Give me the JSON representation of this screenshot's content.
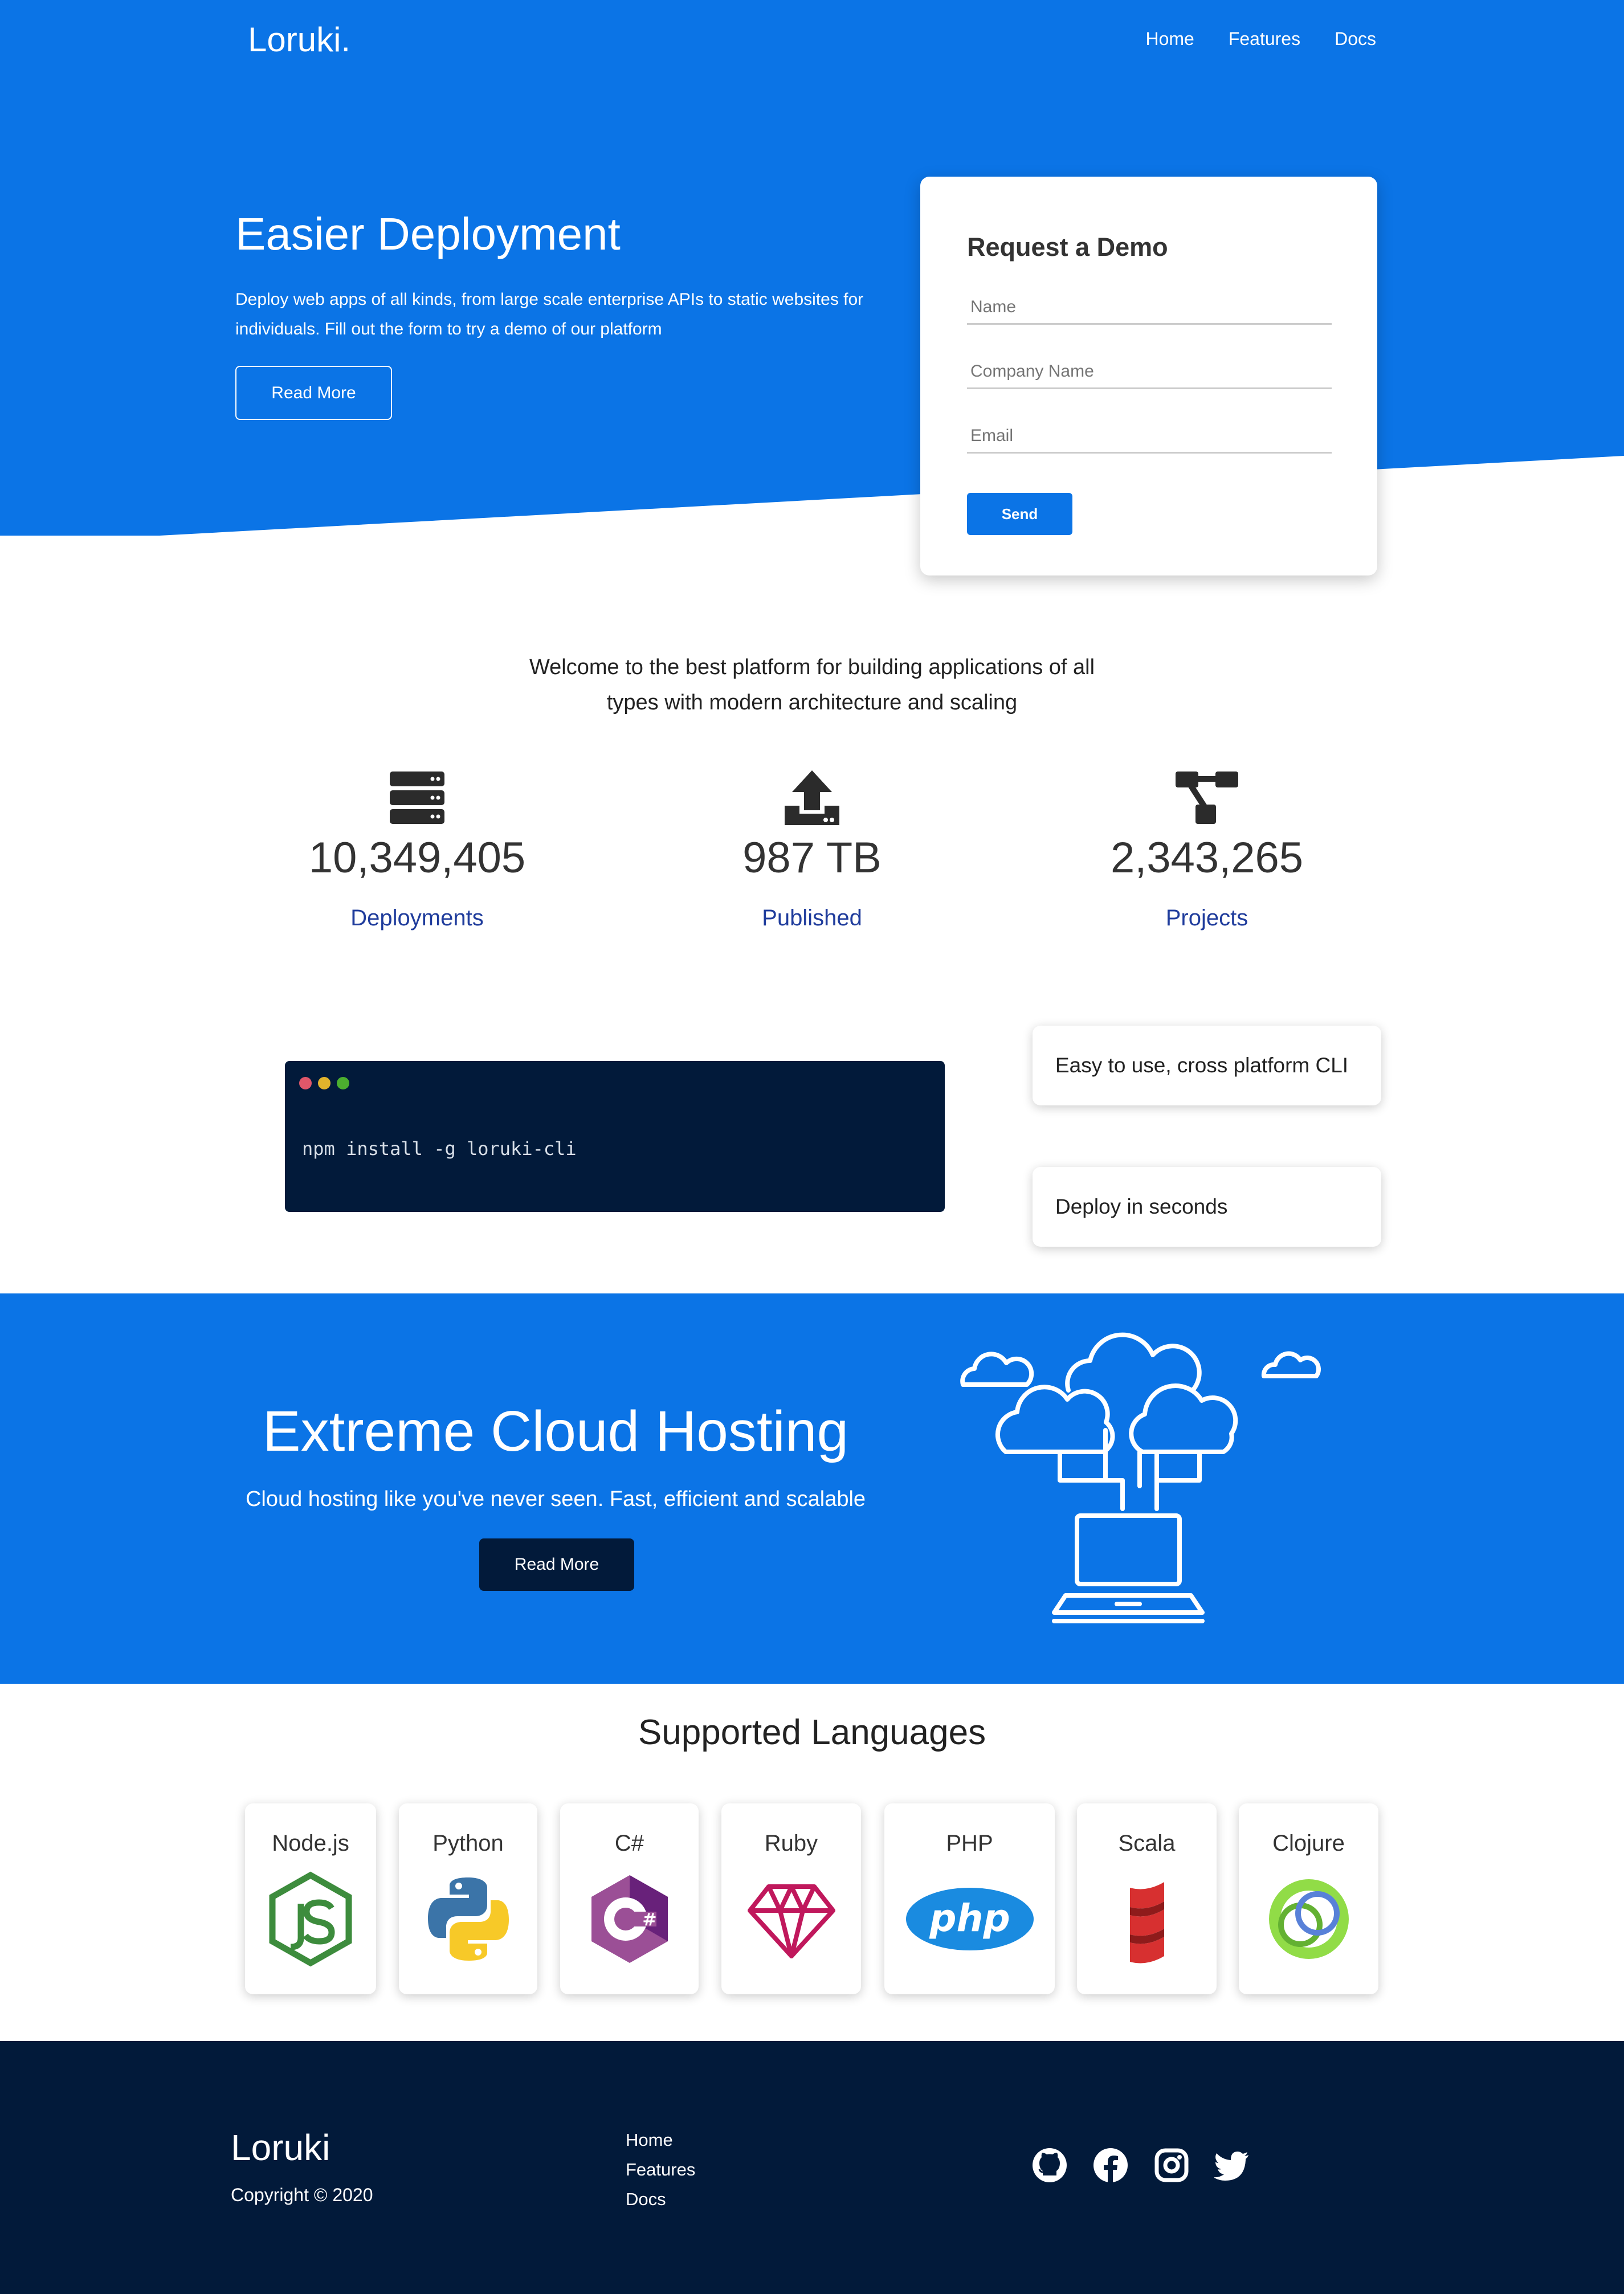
{
  "brand": "Loruki.",
  "nav": [
    "Home",
    "Features",
    "Docs"
  ],
  "hero": {
    "title": "Easier Deployment",
    "text": "Deploy web apps of all kinds, from large scale enterprise APIs to static websites for individuals. Fill out the form to try a demo of our platform",
    "button": "Read More"
  },
  "demo_form": {
    "title": "Request a Demo",
    "name_placeholder": "Name",
    "company_placeholder": "Company Name",
    "email_placeholder": "Email",
    "send_label": "Send"
  },
  "welcome": "Welcome to the best platform for building applications of all types with modern architecture and scaling",
  "stats": [
    {
      "icon": "server-icon",
      "value": "10,349,405",
      "label": "Deployments"
    },
    {
      "icon": "upload-icon",
      "value": "987 TB",
      "label": "Published"
    },
    {
      "icon": "project-diagram-icon",
      "value": "2,343,265",
      "label": "Projects"
    }
  ],
  "terminal": {
    "command": "npm install -g loruki-cli"
  },
  "features": [
    "Easy to use, cross platform CLI",
    "Deploy in seconds"
  ],
  "cloud": {
    "title": "Extreme Cloud Hosting",
    "text": "Cloud hosting like you've never seen. Fast, efficient and scalable",
    "button": "Read More"
  },
  "languages": {
    "title": "Supported Languages",
    "items": [
      "Node.js",
      "Python",
      "C#",
      "Ruby",
      "PHP",
      "Scala",
      "Clojure"
    ]
  },
  "footer": {
    "brand": "Loruki",
    "copyright": "Copyright © 2020",
    "links": [
      "Home",
      "Features",
      "Docs"
    ],
    "social_icons": [
      "github-icon",
      "facebook-icon",
      "instagram-icon",
      "twitter-icon"
    ]
  },
  "colors": {
    "primary": "#0b74e6",
    "dark": "#021a3a",
    "stat_label": "#1f3c9c"
  }
}
